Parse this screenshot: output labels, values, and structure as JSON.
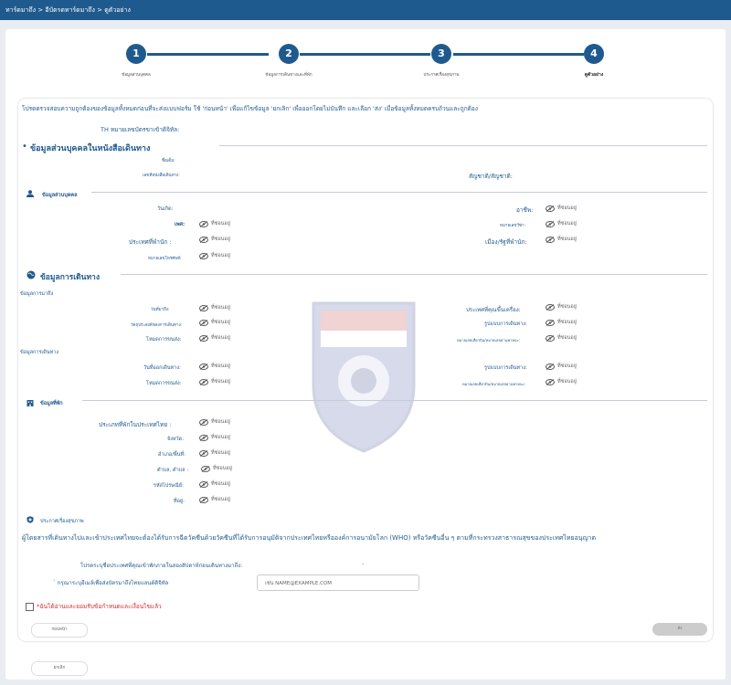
{
  "breadcrumb": "ทาร์ดมาถึง > อีบัตรดทาร์ดมาถึง > ดูตัวอย่าง",
  "steps": [
    {
      "num": "1",
      "label": "ข้อมูลส่วนบุคคล"
    },
    {
      "num": "2",
      "label": "ข้อมูลการเดินทางและที่พัก"
    },
    {
      "num": "3",
      "label": "ประกาศเรื่องสุขภาพ"
    },
    {
      "num": "4",
      "label": "ดูตัวอย่าง"
    }
  ],
  "instruction": "โปรดตรวจสอบความถูกต้องของข้อมูลทั้งหมดก่อนที่จะส่งแบบฟอร์ม ใช้ 'ก่อนหน้า' เพื่อแก้ไขข้อมูล 'ยกเลิก' เพื่อออกโดยไม่บันทึก และเลือก 'ส่ง' เมื่อข้อมูลทั้งหมดครบถ้วนและถูกต้อง",
  "tdac_label": "TH หมายเลขบัตรขาเข้าดิจิทัล:",
  "hidden_text": "ที่ซ่อนอยู่",
  "passport_section": {
    "title": "ข้อมูลส่วนบุคคลในหนังสือเดินทาง",
    "name_label": "ชื่อเต็ม:",
    "passport_no_label": "เลขที่หนังสือเดินทาง:",
    "nationality_label": "สัญชาติ/สัญชาติ:"
  },
  "personal": {
    "title": "ข้อมูลส่วนบุคคล",
    "birth_label": "วันเกิด:",
    "occupation_label": "อาชีพ:",
    "sex_label": "เพศ:",
    "visa_label": "หมายเลขวีซ่า:",
    "country_label": "ประเทศที่พำนัก :",
    "city_label": "เมือง/รัฐที่พำนัก:",
    "phone_label": "หมายเลขโทรศัพท์:"
  },
  "travel": {
    "title": "ข้อมูลการเดินทาง",
    "arrival_title": "ข้อมูลการมาถึง",
    "arrival_date": "วันที่มาถึง:",
    "boarding_country": "ประเทศที่คุณขึ้นเครื่อง:",
    "purpose": "วัตถุประสงค์ของการเดินทาง:",
    "travel_mode": "รูปแบบการเดินทาง:",
    "transport_mode": "โหมดการขนส่ง:",
    "flight_no": "หมายเลขเที่ยวบิน/หมายเลขยานพาหนะ:",
    "departure_title": "ข้อมูลการเดินทาง",
    "departure_date": "วันที่ออกเดินทาง:",
    "dep_travel_mode": "รูปแบบการเดินทาง:",
    "dep_transport_mode": "โหมดการขนส่ง:",
    "dep_flight_no": "หมายเลขเที่ยวบิน/หมายเลขยานพาหนะ:"
  },
  "accommodation": {
    "title": "ข้อมูลที่พัก",
    "country": "ประเภทที่พักในประเทศไทย :",
    "province": "จังหวัด:",
    "district": "อำเภอ/พื้นที่:",
    "subdistrict": "ตำบล, ตำบล :",
    "postcode": "รหัสไปรษณีย์:",
    "address": "ที่อยู่:"
  },
  "health": {
    "title": "ประกาศเรื่องสุขภาพ",
    "notice": "ผู้โดยสารที่เดินทางไปและเข้าประเทศไทยจะต้องได้รับการฉีดวัคซีนด้วยวัคซีนที่ได้รับการอนุมัติจากประเทศไทยหรือองค์การอนามัยโลก (WHO) หรือวัคซีนอื่น ๆ ตามที่กระทรวงสาธารณสุขของประเทศไทยอนุญาต",
    "countries_label": "โปรดระบุชื่อประเทศที่คุณเข้าพักภายในสองสัปดาห์ก่อนเดินทางมาถึง:",
    "countries_value": "-",
    "email_label": "กรุณาระบุอีเมล์เพื่อส่งบัตรมาถึงไทยแลนด์ดิจิทัล",
    "email_placeholder": "เช่น NAME@EXAMPLE.COM"
  },
  "agreement": "*ฉันได้อ่านและยอมรับข้อกำหนดและเงื่อนไขแล้ว",
  "buttons": {
    "previous": "ก่อนหน้า",
    "submit": "ส่ง",
    "cancel": "ยกเลิก"
  },
  "colors": {
    "primary": "#1f5a8e",
    "required": "#d32f2f"
  }
}
